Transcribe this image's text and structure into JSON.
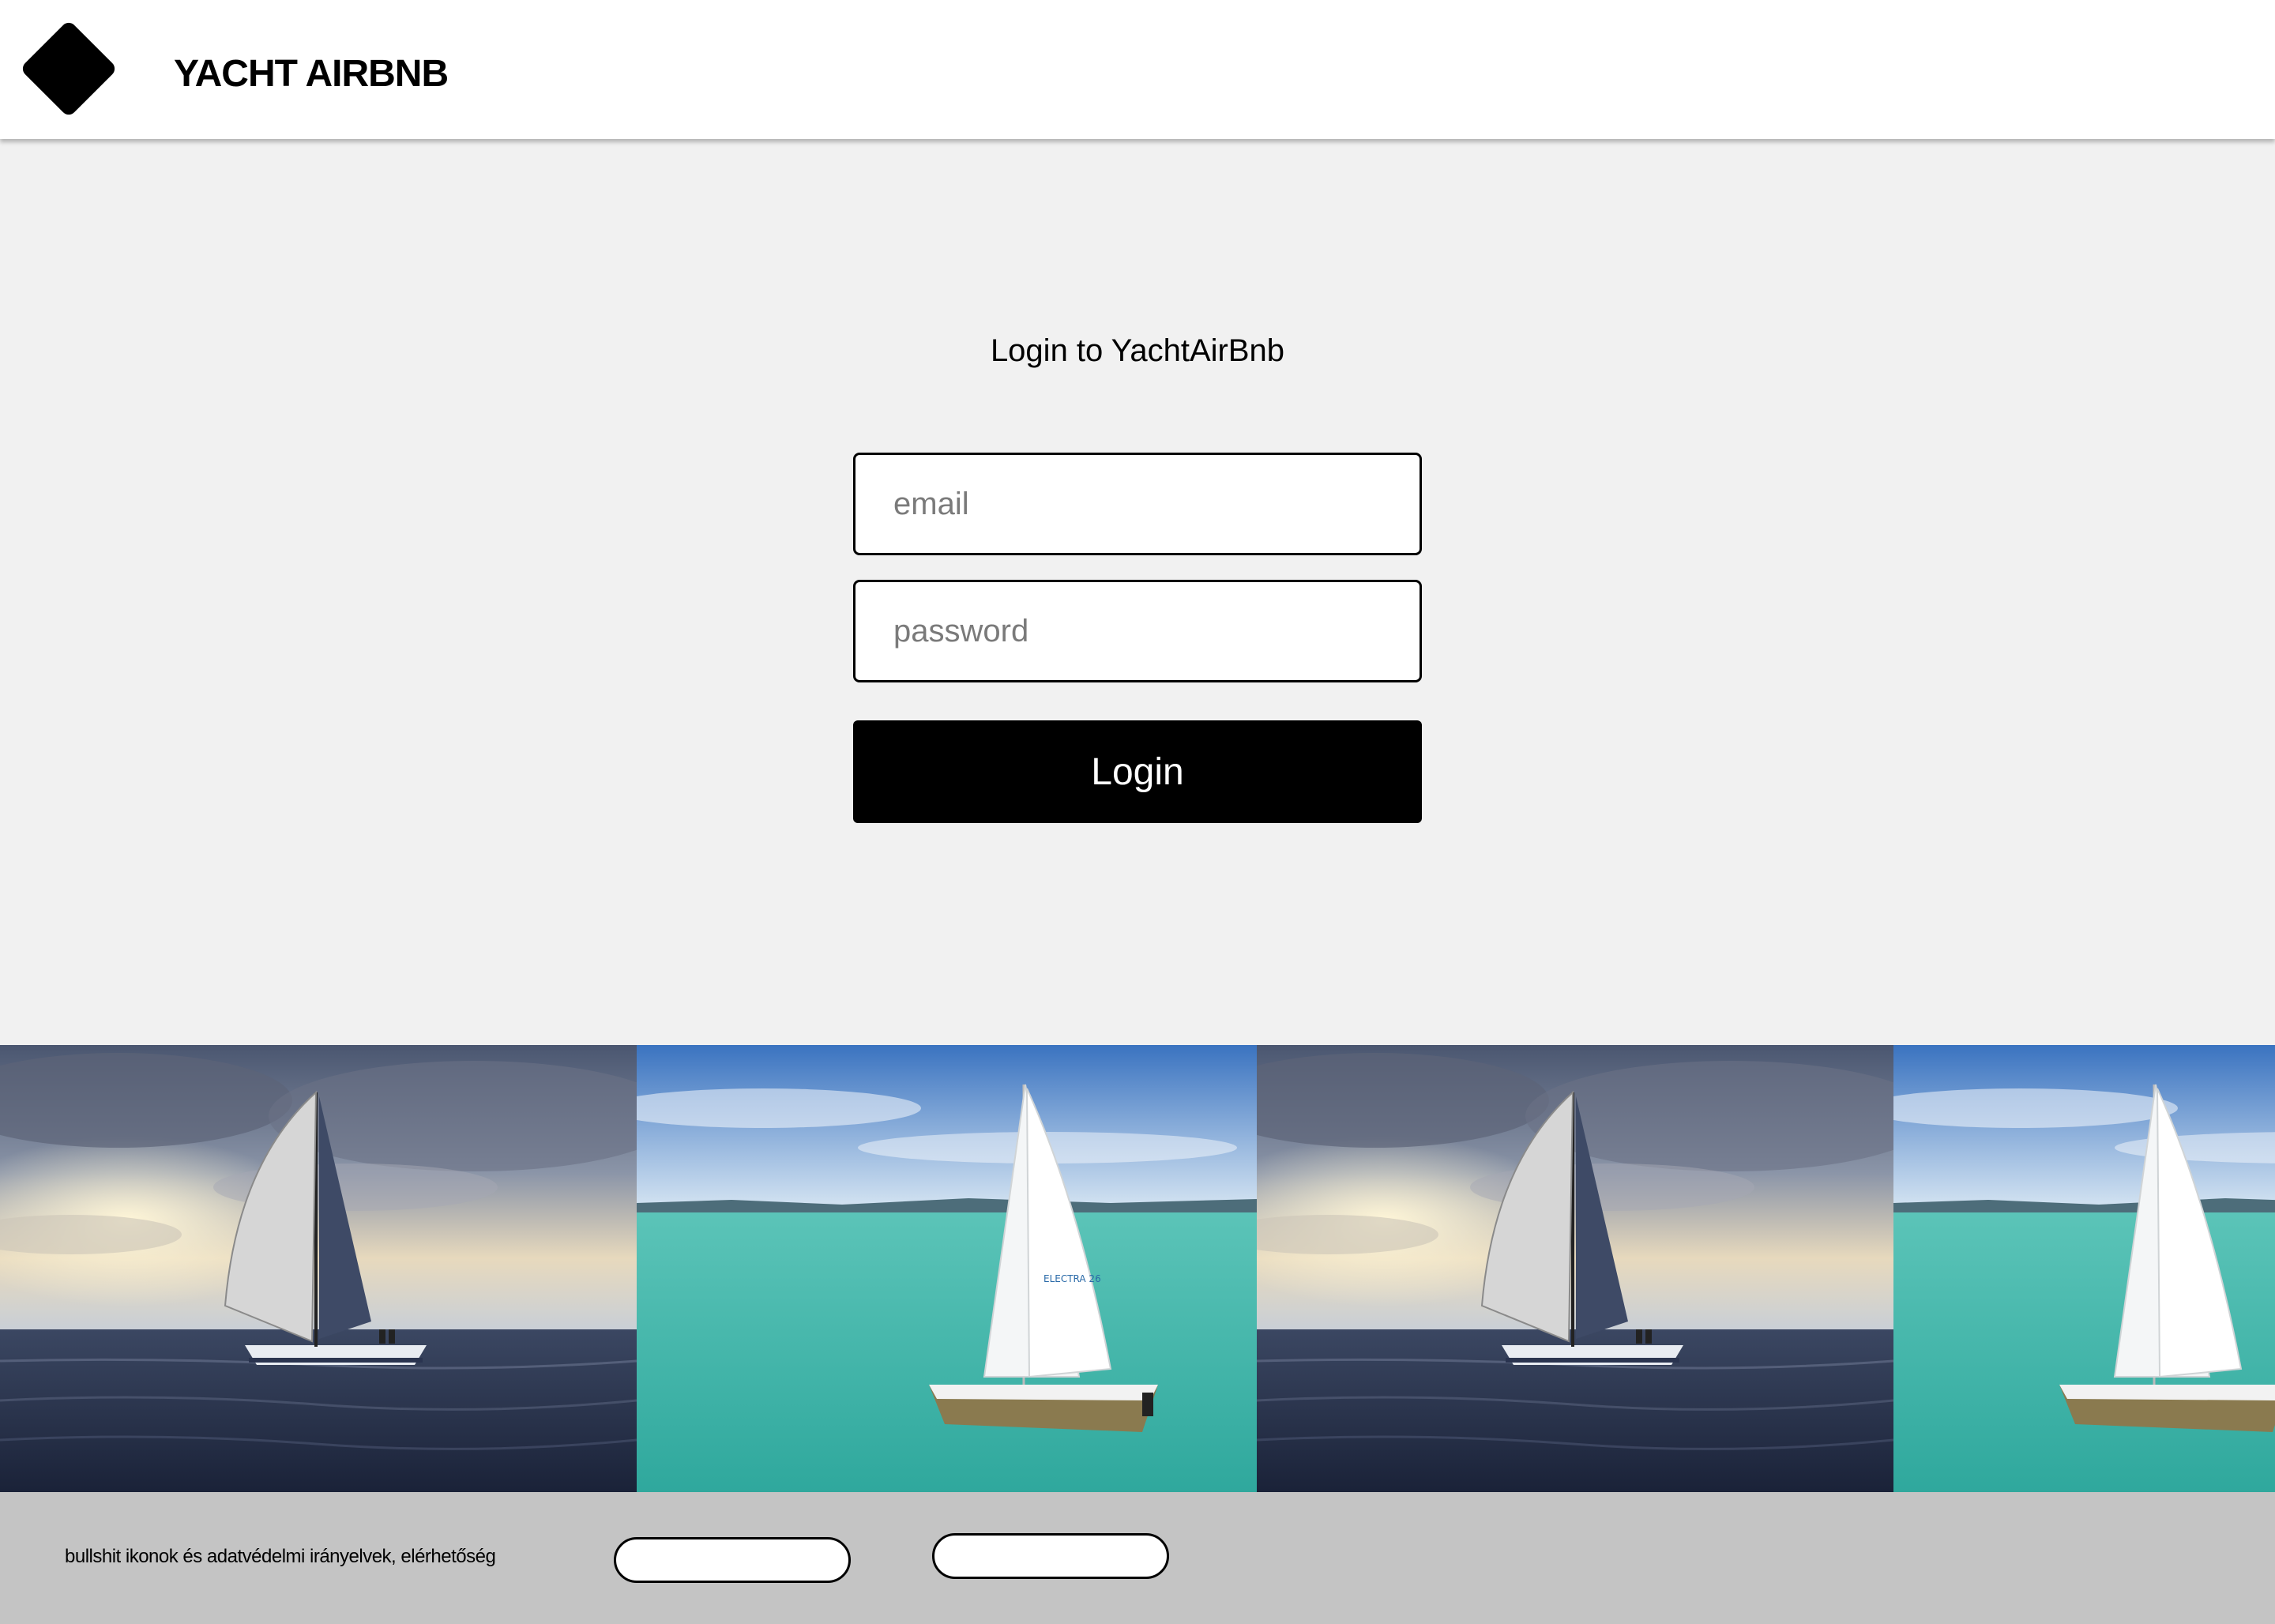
{
  "header": {
    "brand": "YACHT AIRBNB",
    "logo_icon": "diamond-logo-icon"
  },
  "login": {
    "title": "Login to YachtAirBnb",
    "email_placeholder": "email",
    "email_value": "",
    "password_placeholder": "password",
    "password_value": "",
    "button_label": "Login"
  },
  "gallery": {
    "photos": [
      {
        "scene": "sailboat-sunset"
      },
      {
        "scene": "sailboat-turquoise-lake"
      },
      {
        "scene": "sailboat-sunset"
      },
      {
        "scene": "sailboat-turquoise-lake"
      }
    ]
  },
  "footer": {
    "text": "bullshit ikonok és adatvédelmi irányelvek, elérhetőség",
    "buttons": [
      "",
      ""
    ]
  },
  "colors": {
    "page_bg": "#f1f1f1",
    "header_bg": "#ffffff",
    "footer_bg": "#c4c4c4",
    "button_bg": "#000000",
    "button_text": "#ffffff"
  }
}
